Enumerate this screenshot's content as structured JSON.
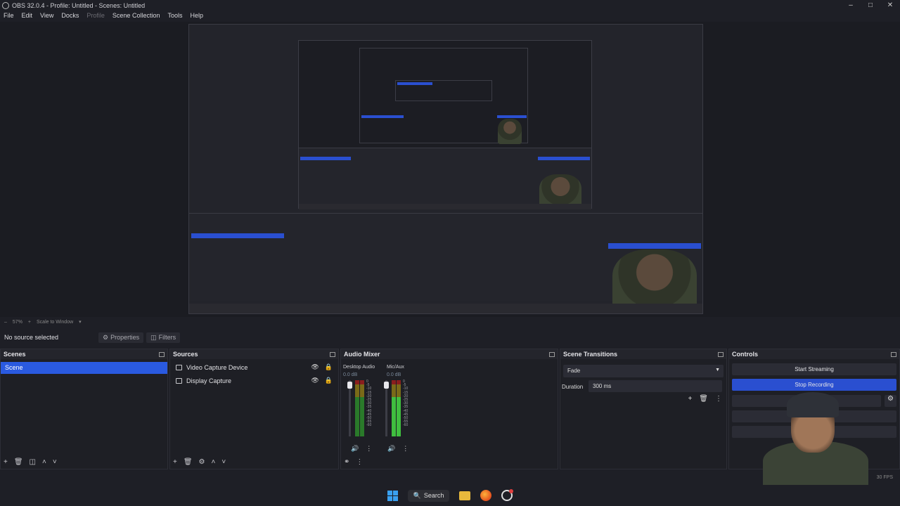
{
  "window": {
    "title": "OBS 32.0.4 - Profile: Untitled - Scenes: Untitled"
  },
  "menu": {
    "items": [
      "File",
      "Edit",
      "View",
      "Docks",
      "Profile",
      "Scene Collection",
      "Tools",
      "Help"
    ]
  },
  "toolbar": {
    "zoom": "57%",
    "scale_mode": "Scale to Window"
  },
  "context": {
    "no_source": "No source selected",
    "properties_label": "Properties",
    "filters_label": "Filters"
  },
  "scenes": {
    "title": "Scenes",
    "items": [
      "Scene"
    ]
  },
  "sources": {
    "title": "Sources",
    "items": [
      "Video Capture Device",
      "Display Capture"
    ]
  },
  "mixer": {
    "title": "Audio Mixer",
    "channels": [
      {
        "name": "Desktop Audio",
        "db": "0.0 dB"
      },
      {
        "name": "Mic/Aux",
        "db": "0.0 dB"
      }
    ],
    "ticks": [
      "0",
      "-5",
      "-10",
      "-15",
      "-20",
      "-25",
      "-30",
      "-35",
      "-40",
      "-45",
      "-50",
      "-55",
      "-60"
    ]
  },
  "transitions": {
    "title": "Scene Transitions",
    "selected": "Fade",
    "duration_label": "Duration",
    "duration_value": "300 ms"
  },
  "controls": {
    "title": "Controls",
    "start_streaming": "Start Streaming",
    "stop_recording": "Stop Recording",
    "start_virtual": "Start V"
  },
  "statusbar": {
    "fps": "30 FPS"
  },
  "taskbar": {
    "search_label": "Search"
  }
}
